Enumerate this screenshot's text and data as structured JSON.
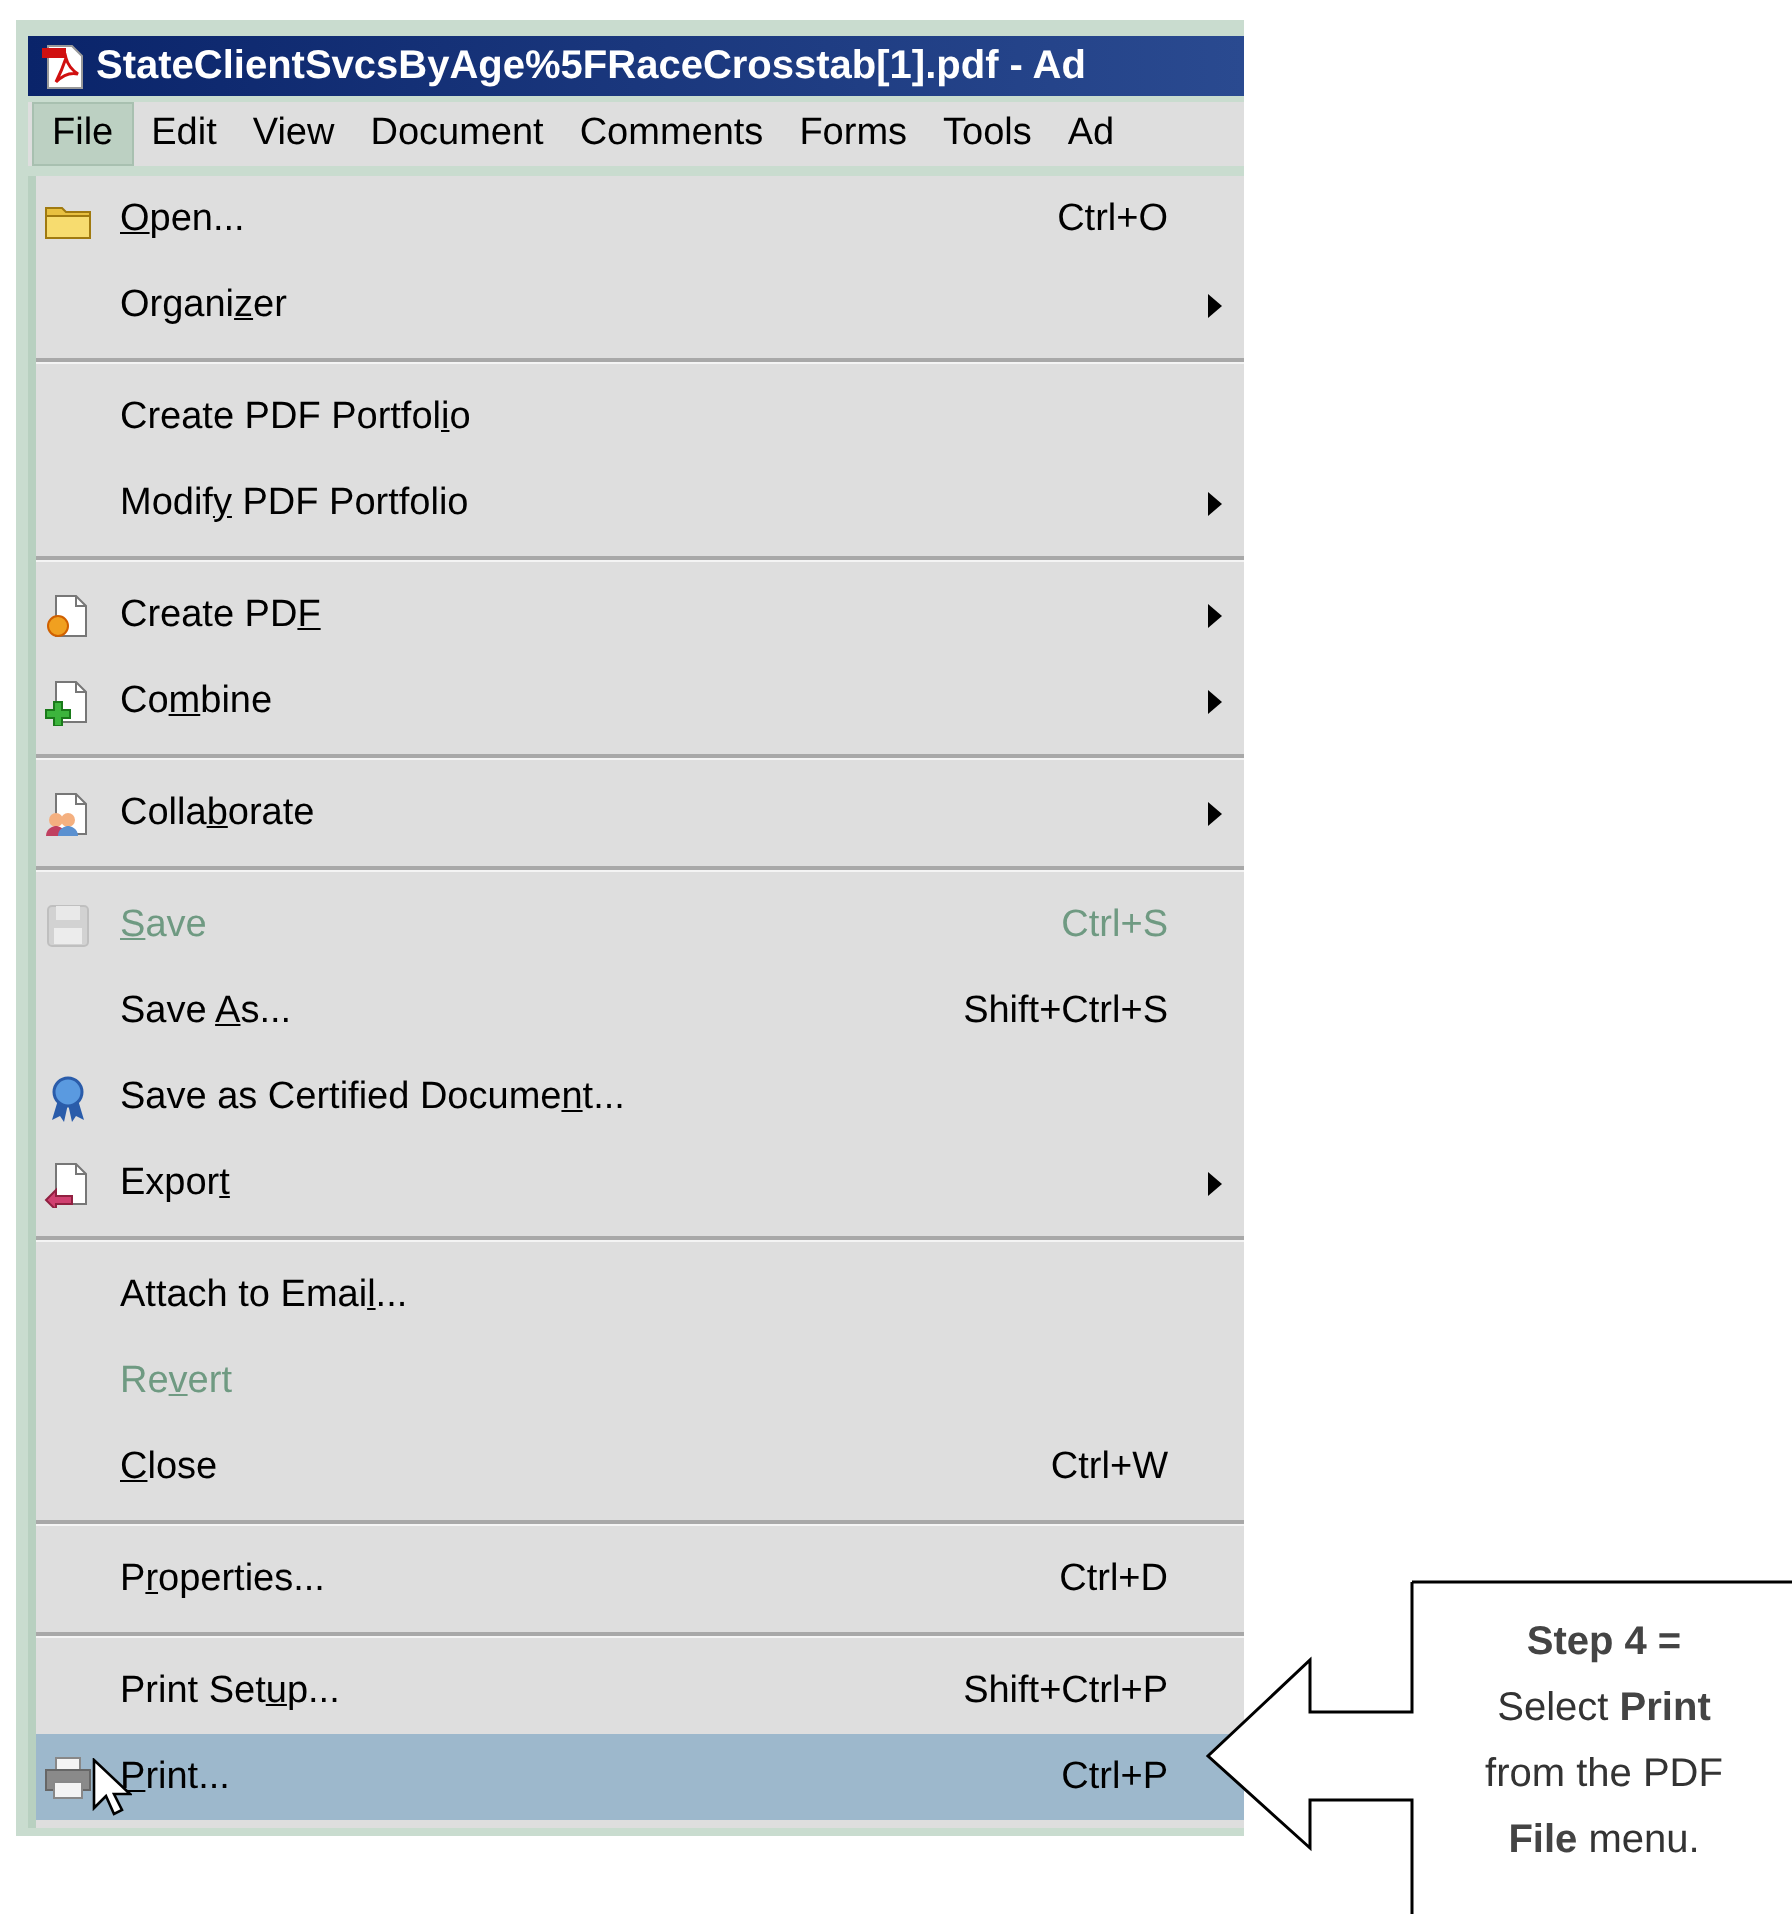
{
  "window": {
    "title": "StateClientSvcsByAge%5FRaceCrosstab[1].pdf - Ad"
  },
  "menu_bar": [
    {
      "label": "File",
      "selected": true
    },
    {
      "label": "Edit",
      "selected": false
    },
    {
      "label": "View",
      "selected": false
    },
    {
      "label": "Document",
      "selected": false
    },
    {
      "label": "Comments",
      "selected": false
    },
    {
      "label": "Forms",
      "selected": false
    },
    {
      "label": "Tools",
      "selected": false
    },
    {
      "label": "Ad",
      "selected": false
    }
  ],
  "file_menu": [
    [
      {
        "kind": "folder",
        "key": "O",
        "post": "pen...",
        "shortcut": "Ctrl+O",
        "submenu": false,
        "disabled": false,
        "selected": false
      },
      {
        "pre": "Organi",
        "key": "z",
        "post": "er",
        "submenu": true,
        "disabled": false,
        "selected": false
      }
    ],
    [
      {
        "pre": "Create PDF Portfol",
        "key": "i",
        "post": "o",
        "submenu": false,
        "disabled": false,
        "selected": false
      },
      {
        "pre": "Modif",
        "key": "y",
        "post": " PDF Portfolio",
        "submenu": true,
        "disabled": false,
        "selected": false
      }
    ],
    [
      {
        "kind": "create",
        "pre": "Create PD",
        "key": "F",
        "submenu": true,
        "disabled": false,
        "selected": false
      },
      {
        "kind": "combine",
        "pre": "Co",
        "key": "m",
        "post": "bine",
        "submenu": true,
        "disabled": false,
        "selected": false
      }
    ],
    [
      {
        "kind": "collaborate",
        "pre": "Colla",
        "key": "b",
        "post": "orate",
        "submenu": true,
        "disabled": false,
        "selected": false
      }
    ],
    [
      {
        "kind": "save",
        "key": "S",
        "post": "ave",
        "shortcut": "Ctrl+S",
        "submenu": false,
        "disabled": true,
        "selected": false
      },
      {
        "pre": "Save ",
        "key": "A",
        "post": "s...",
        "shortcut": "Shift+Ctrl+S",
        "submenu": false,
        "disabled": false,
        "selected": false
      },
      {
        "kind": "certified",
        "pre": "Save as Certified Docume",
        "key": "n",
        "post": "t...",
        "submenu": false,
        "disabled": false,
        "selected": false
      },
      {
        "kind": "export",
        "pre": "Expor",
        "key": "t",
        "submenu": true,
        "disabled": false,
        "selected": false
      }
    ],
    [
      {
        "pre": "Attach to Emai",
        "key": "l",
        "post": "...",
        "submenu": false,
        "disabled": false,
        "selected": false
      },
      {
        "pre": "Re",
        "key": "v",
        "post": "ert",
        "submenu": false,
        "disabled": true,
        "selected": false
      },
      {
        "key": "C",
        "post": "lose",
        "shortcut": "Ctrl+W",
        "submenu": false,
        "disabled": false,
        "selected": false
      }
    ],
    [
      {
        "pre": "P",
        "key": "r",
        "post": "operties...",
        "shortcut": "Ctrl+D",
        "submenu": false,
        "disabled": false,
        "selected": false
      }
    ],
    [
      {
        "pre": "Print Set",
        "key": "u",
        "post": "p...",
        "shortcut": "Shift+Ctrl+P",
        "submenu": false,
        "disabled": false,
        "selected": false
      },
      {
        "kind": "print",
        "key": "P",
        "post": "rint...",
        "shortcut": "Ctrl+P",
        "submenu": false,
        "disabled": false,
        "selected": true
      }
    ]
  ],
  "callout": {
    "lines": [
      "**Step 4 =**",
      "Select **Print**",
      "from the PDF",
      "**File** menu."
    ]
  }
}
